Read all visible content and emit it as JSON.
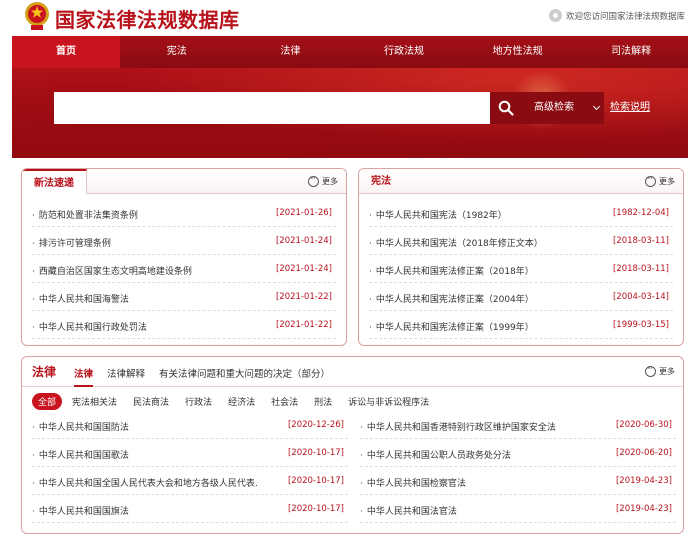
{
  "header": {
    "site_title": "国家法律法规数据库",
    "welcome": "欢迎您访问国家法律法规数据库"
  },
  "nav": {
    "items": [
      "首页",
      "宪法",
      "法律",
      "行政法规",
      "地方性法规",
      "司法解释"
    ],
    "active_index": 0
  },
  "search": {
    "value": "",
    "advanced_label": "高级检索",
    "help_label": "检索说明"
  },
  "colors": {
    "brand_red": "#b8121b",
    "nav_bg": "#8a0b11"
  },
  "new_laws": {
    "title": "新法速递",
    "more": "更多",
    "items": [
      {
        "title": "防范和处置非法集资条例",
        "date": "[2021-01-26]"
      },
      {
        "title": "排污许可管理条例",
        "date": "[2021-01-24]"
      },
      {
        "title": "西藏自治区国家生态文明高地建设条例",
        "date": "[2021-01-24]"
      },
      {
        "title": "中华人民共和国海警法",
        "date": "[2021-01-22]"
      },
      {
        "title": "中华人民共和国行政处罚法",
        "date": "[2021-01-22]"
      }
    ]
  },
  "constitution": {
    "title": "宪法",
    "more": "更多",
    "items": [
      {
        "title": "中华人民共和国宪法（1982年）",
        "date": "[1982-12-04]"
      },
      {
        "title": "中华人民共和国宪法（2018年修正文本）",
        "date": "[2018-03-11]"
      },
      {
        "title": "中华人民共和国宪法修正案（2018年）",
        "date": "[2018-03-11]"
      },
      {
        "title": "中华人民共和国宪法修正案（2004年）",
        "date": "[2004-03-14]"
      },
      {
        "title": "中华人民共和国宪法修正案（1999年）",
        "date": "[1999-03-15]"
      }
    ]
  },
  "laws": {
    "title": "法律",
    "more": "更多",
    "tabs": [
      "法律",
      "法律解释",
      "有关法律问题和重大问题的决定（部分）"
    ],
    "chips": [
      "全部",
      "宪法相关法",
      "民法商法",
      "行政法",
      "经济法",
      "社会法",
      "刑法",
      "诉讼与非诉讼程序法"
    ],
    "left": [
      {
        "title": "中华人民共和国国防法",
        "date": "[2020-12-26]"
      },
      {
        "title": "中华人民共和国国歌法",
        "date": "[2020-10-17]"
      },
      {
        "title": "中华人民共和国全国人民代表大会和地方各级人民代表…",
        "date": "[2020-10-17]"
      },
      {
        "title": "中华人民共和国国旗法",
        "date": "[2020-10-17]"
      }
    ],
    "right": [
      {
        "title": "中华人民共和国香港特别行政区维护国家安全法",
        "date": "[2020-06-30]"
      },
      {
        "title": "中华人民共和国公职人员政务处分法",
        "date": "[2020-06-20]"
      },
      {
        "title": "中华人民共和国检察官法",
        "date": "[2019-04-23]"
      },
      {
        "title": "中华人民共和国法官法",
        "date": "[2019-04-23]"
      }
    ]
  }
}
